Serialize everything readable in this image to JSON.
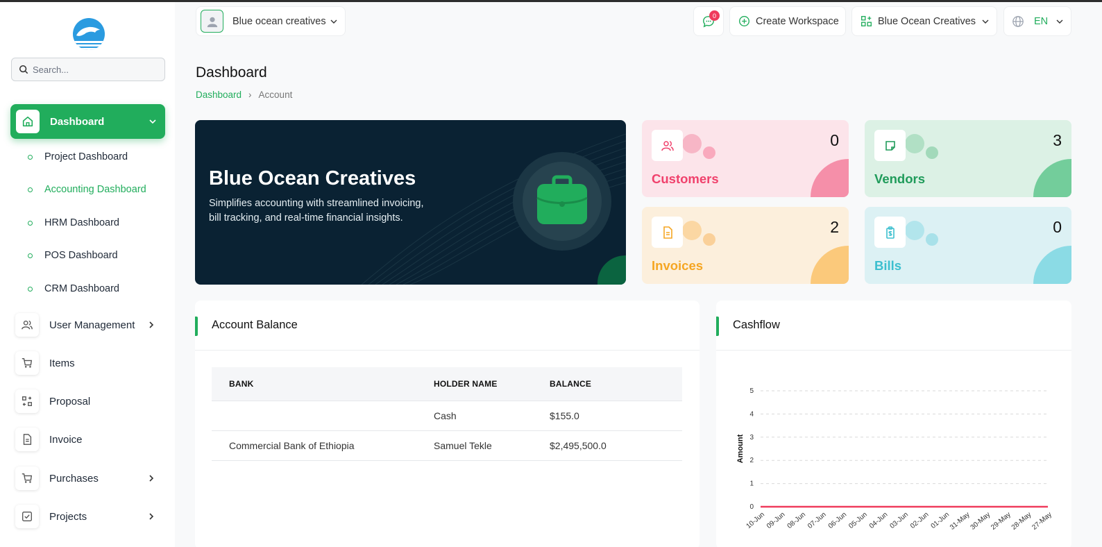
{
  "sidebar": {
    "search_placeholder": "Search...",
    "active": {
      "label": "Dashboard",
      "icon": "home-icon"
    },
    "sub_items": [
      {
        "label": "Project Dashboard",
        "active": false
      },
      {
        "label": "Accounting Dashboard",
        "active": true
      },
      {
        "label": "HRM Dashboard",
        "active": false
      },
      {
        "label": "POS Dashboard",
        "active": false
      },
      {
        "label": "CRM Dashboard",
        "active": false
      }
    ],
    "items": [
      {
        "label": "User Management",
        "icon": "users-icon",
        "has_children": true
      },
      {
        "label": "Items",
        "icon": "cart-icon",
        "has_children": false
      },
      {
        "label": "Proposal",
        "icon": "proposal-icon",
        "has_children": false
      },
      {
        "label": "Invoice",
        "icon": "document-icon",
        "has_children": false
      },
      {
        "label": "Purchases",
        "icon": "cart-icon",
        "has_children": true
      },
      {
        "label": "Projects",
        "icon": "checkbox-icon",
        "has_children": true
      }
    ]
  },
  "topbar": {
    "workspace": "Blue ocean creatives",
    "messages_count": "0",
    "create_workspace": "Create Workspace",
    "company": "Blue Ocean Creatives",
    "language": "EN"
  },
  "page": {
    "title": "Dashboard",
    "breadcrumb": [
      "Dashboard",
      "Account"
    ]
  },
  "hero": {
    "title": "Blue Ocean Creatives",
    "description": "Simplifies accounting with streamlined invoicing, bill tracking, and real-time financial insights."
  },
  "stats": [
    {
      "label": "Customers",
      "value": "0",
      "color": "#f0416c",
      "bg": "#fce4ea",
      "blob": "#f58fa9",
      "c1": "#f7b6c6",
      "c2": "#f9a9bd",
      "icon": "customers-icon"
    },
    {
      "label": "Vendors",
      "value": "3",
      "color": "#1f9b5a",
      "bg": "#dcf1e5",
      "blob": "#73cd9b",
      "c1": "#b1e0c5",
      "c2": "#a2d9ba",
      "icon": "note-icon"
    },
    {
      "label": "Invoices",
      "value": "2",
      "color": "#f5a623",
      "bg": "#fcefdc",
      "blob": "#fbc97b",
      "c1": "#fbd7a3",
      "c2": "#fad099",
      "icon": "invoice-icon"
    },
    {
      "label": "Bills",
      "value": "0",
      "color": "#3cbfcf",
      "bg": "#dcf1f4",
      "blob": "#8bdbe5",
      "c1": "#b2e5ec",
      "c2": "#a8e1e9",
      "icon": "bill-icon"
    }
  ],
  "account_balance": {
    "title": "Account Balance",
    "columns": [
      "BANK",
      "HOLDER NAME",
      "BALANCE"
    ],
    "rows": [
      {
        "bank": "",
        "holder": "Cash",
        "balance": "$155.0"
      },
      {
        "bank": "Commercial Bank of Ethiopia",
        "holder": "Samuel Tekle",
        "balance": "$2,495,500.0"
      }
    ]
  },
  "cashflow": {
    "title": "Cashflow",
    "colors": {
      "line": "#ef3b5c",
      "grid": "#d9d9d9"
    }
  },
  "chart_data": {
    "type": "line",
    "title": "",
    "xlabel": "",
    "ylabel": "Amount",
    "categories": [
      "10-Jun",
      "09-Jun",
      "08-Jun",
      "07-Jun",
      "06-Jun",
      "05-Jun",
      "04-Jun",
      "03-Jun",
      "02-Jun",
      "01-Jun",
      "31-May",
      "30-May",
      "29-May",
      "28-May",
      "27-May"
    ],
    "yticks": [
      0,
      1,
      2,
      3,
      4,
      5
    ],
    "ylim": [
      0,
      5
    ],
    "grid": true,
    "series": [
      {
        "values": [
          0,
          0,
          0,
          0,
          0,
          0,
          0,
          0,
          0,
          0,
          0,
          0,
          0,
          0,
          0
        ]
      }
    ]
  }
}
